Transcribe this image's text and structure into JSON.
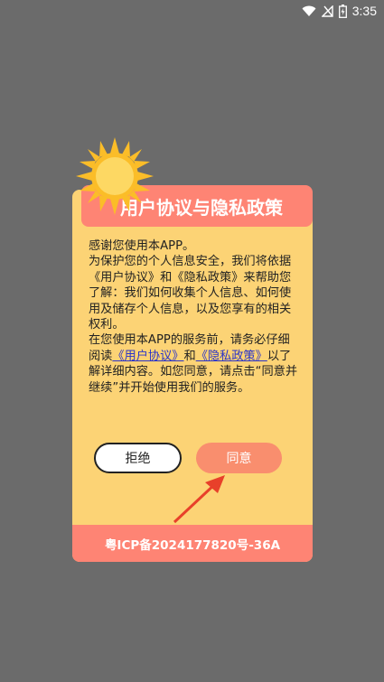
{
  "status_bar": {
    "time": "3:35",
    "icons": [
      "wifi-icon",
      "signal-icon",
      "battery-icon"
    ]
  },
  "dialog": {
    "title": "用户协议与隐私政策",
    "body": {
      "p1": "感谢您使用本APP。",
      "p2": "为保护您的个人信息安全，我们将依据《用户协议》和《隐私政策》来帮助您了解：我们如何收集个人信息、如何使用及储存个人信息，以及您享有的相关权利。",
      "p3_pre": "在您使用本APP的服务前，请务必仔细阅读",
      "link_user_agreement": "《用户协议》",
      "p3_and": "和",
      "link_privacy_policy": "《隐私政策》",
      "p3_post": "以了解详细内容。如您同意，请点击“同意并继续”并开始使用我们的服务。"
    },
    "refuse_label": "拒绝",
    "agree_label": "同意",
    "footer": "粤ICP备2024177820号-36A"
  },
  "colors": {
    "background": "#6b6b6b",
    "dialog_bg": "#fcd375",
    "accent": "#fe8474",
    "agree_button": "#f98e6e",
    "link": "#2a34c9",
    "arrow": "#e8402a",
    "sun": "#fbbd28"
  }
}
